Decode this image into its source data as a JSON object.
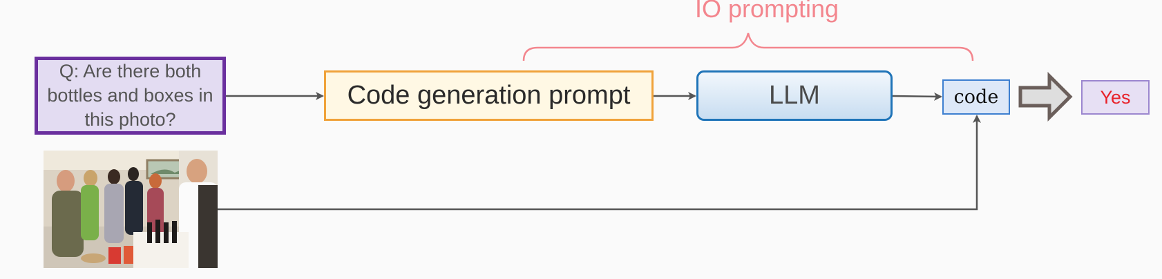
{
  "question": {
    "text": "Q: Are there both bottles and boxes in this photo?"
  },
  "prompt": {
    "label": "Code generation prompt"
  },
  "llm": {
    "label": "LLM"
  },
  "code": {
    "label": "code"
  },
  "answer": {
    "label": "Yes"
  },
  "bracket": {
    "label": "IO prompting"
  },
  "colors": {
    "question_border": "#6a2f9e",
    "prompt_border": "#f0a23a",
    "llm_border": "#1f74b8",
    "code_border": "#3d7fd0",
    "answer_text": "#e8222a",
    "bracket": "#f3868e",
    "arrow": "#555555",
    "big_arrow": "#6b5f5b"
  }
}
